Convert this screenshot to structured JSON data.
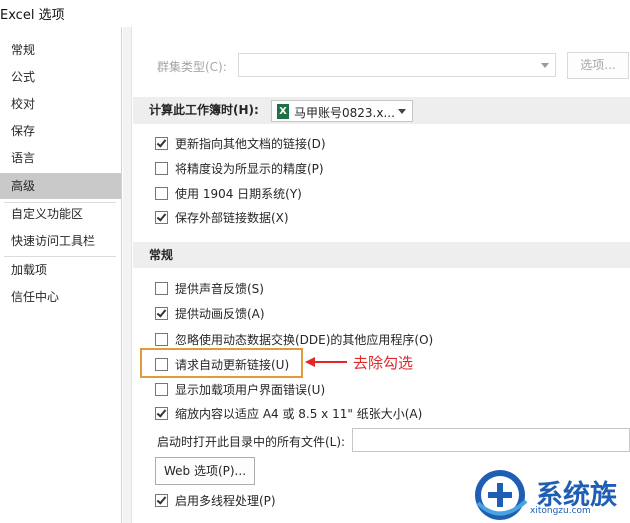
{
  "window": {
    "title": "Excel 选项"
  },
  "nav": {
    "items": [
      {
        "label": "常规",
        "selected": false
      },
      {
        "label": "公式",
        "selected": false
      },
      {
        "label": "校对",
        "selected": false
      },
      {
        "label": "保存",
        "selected": false
      },
      {
        "label": "语言",
        "selected": false
      },
      {
        "label": "高级",
        "selected": true
      },
      {
        "label": "自定义功能区",
        "selected": false
      },
      {
        "label": "快速访问工具栏",
        "selected": false
      },
      {
        "label": "加载项",
        "selected": false
      },
      {
        "label": "信任中心",
        "selected": false
      }
    ]
  },
  "cluster": {
    "label": "群集类型(C):",
    "value": "",
    "options_button": "选项..."
  },
  "calc_section": {
    "title": "计算此工作簿时(H):",
    "workbook_value": "马甲账号0823.x...",
    "checkboxes": [
      {
        "label": "更新指向其他文档的链接(D)",
        "checked": true
      },
      {
        "label": "将精度设为所显示的精度(P)",
        "checked": false
      },
      {
        "label": "使用 1904 日期系统(Y)",
        "checked": false
      },
      {
        "label": "保存外部链接数据(X)",
        "checked": true
      }
    ]
  },
  "general_section": {
    "title": "常规",
    "checkboxes": [
      {
        "label": "提供声音反馈(S)",
        "checked": false
      },
      {
        "label": "提供动画反馈(A)",
        "checked": true
      },
      {
        "label": "忽略使用动态数据交换(DDE)的其他应用程序(O)",
        "checked": false
      },
      {
        "label": "请求自动更新链接(U)",
        "checked": false
      },
      {
        "label": "显示加载项用户界面错误(U)",
        "checked": false
      },
      {
        "label": "缩放内容以适应 A4 或 8.5 x 11\" 纸张大小(A)",
        "checked": true
      }
    ],
    "startup_label": "启动时打开此目录中的所有文件(L):",
    "startup_value": "",
    "web_options_button": "Web 选项(P)...",
    "multithread": {
      "label": "启用多线程处理(P)",
      "checked": true
    }
  },
  "annotation": {
    "text": "去除勾选",
    "color": "#e0282b",
    "box_color": "#e39a3d"
  },
  "watermark": {
    "brand": "系统族",
    "url": "xitongzu.com"
  }
}
